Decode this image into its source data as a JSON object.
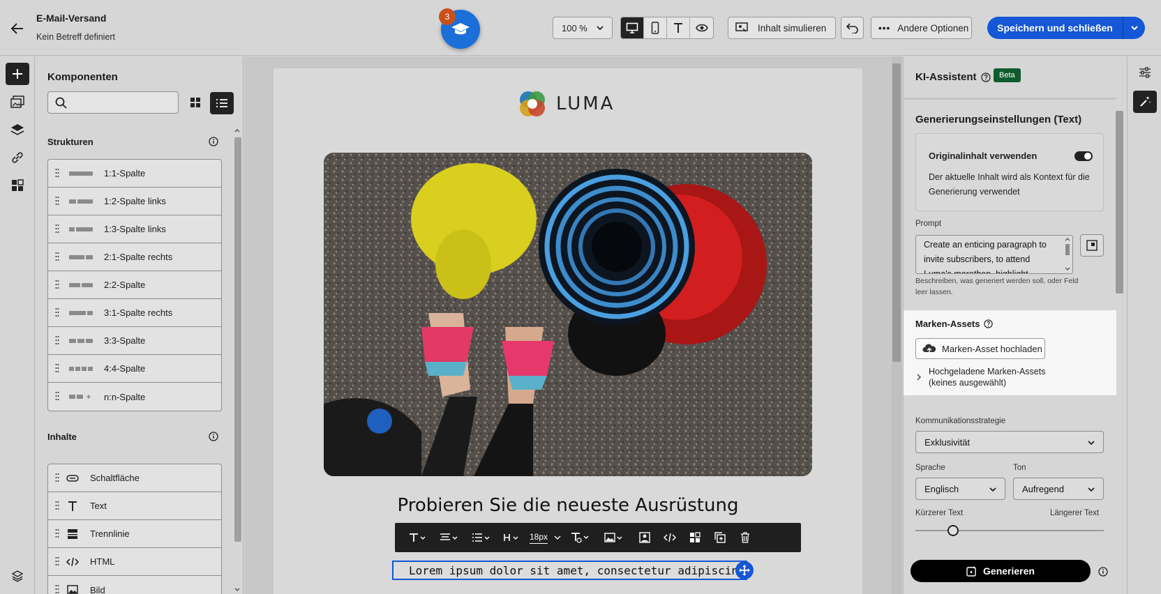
{
  "header": {
    "title": "E-Mail-Versand",
    "subtitle": "Kein Betreff definiert",
    "tour_count": "3",
    "zoom": "100 %",
    "simulate_label": "Inhalt simulieren",
    "more_options_label": "Andere Optionen",
    "save_label": "Speichern und schließen"
  },
  "components": {
    "title": "Komponenten",
    "search_placeholder": "",
    "structures_title": "Strukturen",
    "structures": [
      {
        "label": "1:1-Spalte"
      },
      {
        "label": "1:2-Spalte links"
      },
      {
        "label": "1:3-Spalte links"
      },
      {
        "label": "2:1-Spalte rechts"
      },
      {
        "label": "2:2-Spalte"
      },
      {
        "label": "3:1-Spalte rechts"
      },
      {
        "label": "3:3-Spalte"
      },
      {
        "label": "4:4-Spalte"
      },
      {
        "label": "n:n-Spalte"
      }
    ],
    "contents_title": "Inhalte",
    "contents": [
      {
        "label": "Schaltfläche",
        "icon": "button-icon"
      },
      {
        "label": "Text",
        "icon": "text-icon"
      },
      {
        "label": "Trennlinie",
        "icon": "divider-icon"
      },
      {
        "label": "HTML",
        "icon": "code-icon"
      },
      {
        "label": "Bild",
        "icon": "image-icon"
      }
    ]
  },
  "email": {
    "logo_text": "LUMA",
    "heading": "Probieren Sie die neueste Ausrüstung",
    "body_text": "Lorem ipsum dolor sit amet, consectetur adipiscing elit,",
    "font_size": "18px"
  },
  "ai": {
    "title": "KI-Assistent",
    "beta": "Beta",
    "gen_settings_title": "Generierungseinstellungen  (Text)",
    "original_label": "Originalinhalt verwenden",
    "original_desc": "Der aktuelle Inhalt wird als Kontext für die Generierung verwendet",
    "original_enabled": true,
    "prompt_label": "Prompt",
    "prompt_value": "Create an enticing paragraph to invite subscribers, to attend Luma's marathon, highlight",
    "prompt_hint": "Beschreiben, was generiert werden soll, oder Feld leer lassen.",
    "brand_title": "Marken-Assets",
    "upload_label": "Marken-Asset hochladen",
    "uploaded_label": "Hochgeladene Marken-Assets",
    "uploaded_sub": "(keines ausgewählt)",
    "strategy_label": "Kommunikationsstrategie",
    "strategy_value": "Exklusivität",
    "language_label": "Sprache",
    "language_value": "Englisch",
    "tone_label": "Ton",
    "tone_value": "Aufregend",
    "shorter_label": "Kürzerer Text",
    "longer_label": "Längerer Text",
    "length_level": 0.2,
    "generate_label": "Generieren"
  },
  "colors": {
    "primary": "#1557d6",
    "beta_green": "#0f5c2e"
  }
}
